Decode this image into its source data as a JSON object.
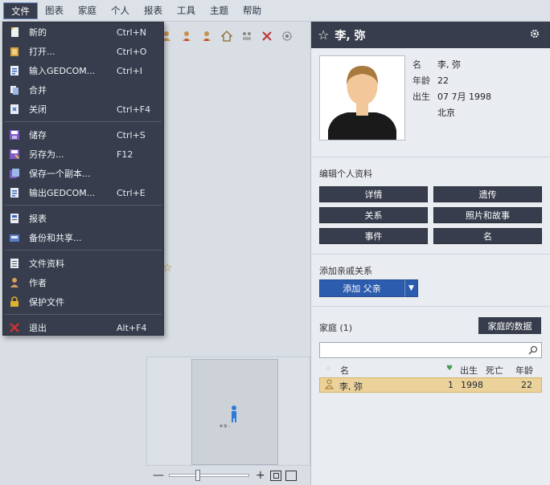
{
  "menubar": {
    "items": [
      "文件",
      "图表",
      "家庭",
      "个人",
      "报表",
      "工具",
      "主题",
      "帮助"
    ]
  },
  "file_menu": {
    "new": {
      "label": "新的",
      "shortcut": "Ctrl+N"
    },
    "open": {
      "label": "打开...",
      "shortcut": "Ctrl+O"
    },
    "import": {
      "label": "输入GEDCOM...",
      "shortcut": "Ctrl+I"
    },
    "merge": {
      "label": "合并",
      "shortcut": ""
    },
    "close": {
      "label": "关闭",
      "shortcut": "Ctrl+F4"
    },
    "save": {
      "label": "储存",
      "shortcut": "Ctrl+S"
    },
    "save_as": {
      "label": "另存为...",
      "shortcut": "F12"
    },
    "save_copy": {
      "label": "保存一个副本...",
      "shortcut": ""
    },
    "export": {
      "label": "输出GEDCOM...",
      "shortcut": "Ctrl+E"
    },
    "reports": {
      "label": "报表",
      "shortcut": ""
    },
    "backup": {
      "label": "备份和共享...",
      "shortcut": ""
    },
    "file_info": {
      "label": "文件资料",
      "shortcut": ""
    },
    "author": {
      "label": "作者",
      "shortcut": ""
    },
    "protect": {
      "label": "保护文件",
      "shortcut": ""
    },
    "exit": {
      "label": "退出",
      "shortcut": "Alt+F4"
    }
  },
  "minimap": {
    "node_text": "李 弥 ..."
  },
  "person": {
    "name": "李, 弥",
    "name_label": "名",
    "age_label": "年龄",
    "age": "22",
    "birth_label": "出生",
    "birth_date": "07 7月 1998",
    "birth_place": "北京"
  },
  "edit_section": {
    "title": "编辑个人资料",
    "details": "详情",
    "genetics": "遗传",
    "relations": "关系",
    "photos": "照片和故事",
    "events": "事件",
    "names": "名"
  },
  "add_relative": {
    "title": "添加亲戚关系",
    "button": "添加 父亲"
  },
  "family": {
    "title": "家庭 (1)",
    "data_button": "家庭的数据",
    "search_placeholder": "",
    "columns": {
      "name": "名",
      "birth": "出生",
      "death": "死亡",
      "age": "年龄"
    },
    "rows": [
      {
        "name": "李, 弥",
        "count": "1",
        "birth": "1998",
        "death": "",
        "age": "22"
      }
    ]
  },
  "colors": {
    "dark": "#373d4c",
    "accent": "#2c5cad",
    "highlight": "#ebd29a"
  }
}
